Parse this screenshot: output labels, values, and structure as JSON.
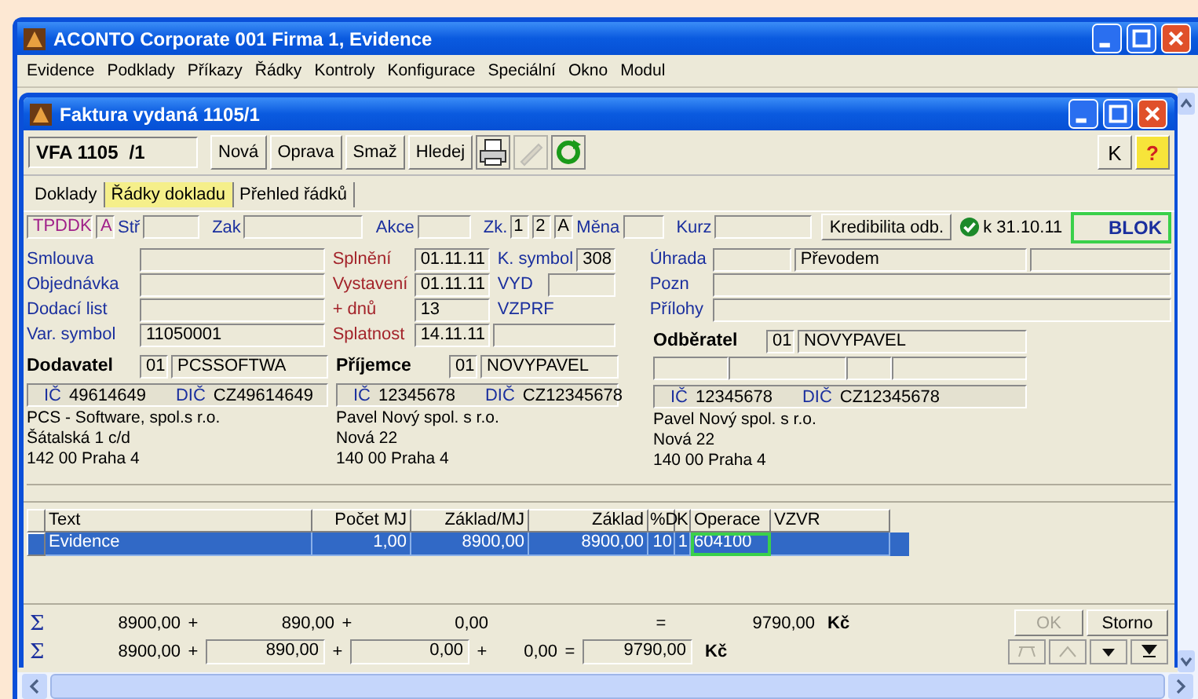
{
  "window": {
    "title": "ACONTO Corporate 001 Firma 1, Evidence"
  },
  "menu": [
    "Evidence",
    "Podklady",
    "Příkazy",
    "Řádky",
    "Kontroly",
    "Konfigurace",
    "Speciální",
    "Okno",
    "Modul"
  ],
  "document": {
    "title": "Faktura vydaná 1105/1",
    "toolbar": {
      "series": "VFA 1105",
      "number": "/1",
      "buttons": [
        "Nová",
        "Oprava",
        "Smaž",
        "Hledej"
      ],
      "icons": [
        {
          "kind": "print",
          "disabled": false
        },
        {
          "kind": "tool",
          "disabled": true
        },
        {
          "kind": "refresh",
          "disabled": false
        }
      ],
      "right_buttons": [
        "K",
        "?"
      ]
    },
    "tabs": [
      {
        "label": "Doklady",
        "selected": false
      },
      {
        "label": "Řádky dokladu",
        "selected": true
      },
      {
        "label": "Přehled řádků",
        "selected": false
      }
    ],
    "header": {
      "code": "TPDDK",
      "code_flag": "A",
      "str_label": "Stř",
      "zak_label": "Zak",
      "akce_label": "Akce",
      "zk_label": "Zk.",
      "zk_values": [
        "1",
        "2",
        "A"
      ],
      "mena_label": "Měna",
      "kurz_label": "Kurz",
      "credit_button": "Kredibilita odb.",
      "credit_ok": true,
      "credit_date": "k 31.10.11",
      "block": "BLOK",
      "block_highlighted": true
    },
    "left_fields": [
      {
        "label": "Smlouva"
      },
      {
        "label": "Objednávka"
      },
      {
        "label": "Dodací list"
      },
      {
        "label": "Var. symbol",
        "value": "11050001"
      }
    ],
    "middle_fields": [
      {
        "label": "Splnění",
        "value": "01.11.11",
        "label2": "K. symbol",
        "value2": "308"
      },
      {
        "label": "Vystavení",
        "value": "01.11.11",
        "label2": "VYD",
        "field2": true
      },
      {
        "label": "+ dnů",
        "value": "13",
        "label2": "VZPRF",
        "field2": false
      },
      {
        "label": "Splatnost",
        "value": "14.11.11",
        "field2": true
      }
    ],
    "right_fields": [
      {
        "label": "Úhrada",
        "value": "Převodem"
      },
      {
        "label": "Pozn"
      },
      {
        "label": "Přílohy"
      }
    ],
    "parties": [
      {
        "role": "Dodavatel",
        "code": "01",
        "name": "PCSSOFTWA",
        "ic_label": "IČ",
        "ic": "49614649",
        "dic_label": "DIČ",
        "dic": "CZ49614649",
        "address": [
          "PCS - Software, spol.s r.o.",
          "Šátalská 1 c/d",
          "142 00 Praha 4"
        ]
      },
      {
        "role": "Příjemce",
        "code": "01",
        "name": "NOVYPAVEL",
        "ic_label": "IČ",
        "ic": "12345678",
        "dic_label": "DIČ",
        "dic": "CZ12345678",
        "address": [
          "Pavel Nový spol. s r.o.",
          "Nová 22",
          "140 00 Praha 4"
        ]
      },
      {
        "role": "Odběratel",
        "code": "01",
        "name": "NOVYPAVEL",
        "ic_label": "IČ",
        "ic": "12345678",
        "dic_label": "DIČ",
        "dic": "CZ12345678",
        "address": [
          "Pavel Nový spol. s r.o.",
          "Nová 22",
          "140 00 Praha 4"
        ]
      }
    ],
    "table": {
      "columns": [
        "Text",
        "Počet MJ",
        "Základ/MJ",
        "Základ",
        "%D",
        "K",
        "Operace",
        "VZVR"
      ],
      "rows": [
        {
          "selected": true,
          "cells": [
            {
              "text": "Evidence",
              "highlighted": false
            },
            {
              "text": "1,00",
              "highlighted": false
            },
            {
              "text": "8900,00",
              "highlighted": false
            },
            {
              "text": "8900,00",
              "highlighted": false
            },
            {
              "text": "10",
              "highlighted": false
            },
            {
              "text": "1",
              "highlighted": false
            },
            {
              "text": "604100",
              "highlighted": true
            }
          ]
        }
      ]
    },
    "totals": [
      [
        {
          "kind": "sigma",
          "text": "Σ"
        },
        {
          "kind": "amount",
          "text": "8900,00"
        },
        {
          "kind": "op",
          "text": "+"
        },
        {
          "kind": "amount",
          "text": "890,00"
        },
        {
          "kind": "op",
          "text": "+"
        },
        {
          "kind": "amount",
          "text": "0,00"
        },
        {
          "kind": "gap"
        },
        {
          "kind": "op",
          "text": "="
        },
        {
          "kind": "amount",
          "text": "9790,00"
        },
        {
          "kind": "unit",
          "text": "Kč"
        }
      ],
      [
        {
          "kind": "sigma",
          "text": "Σ"
        },
        {
          "kind": "amount",
          "text": "8900,00"
        },
        {
          "kind": "op",
          "text": "+"
        },
        {
          "kind": "boxed",
          "text": "890,00"
        },
        {
          "kind": "op",
          "text": "+"
        },
        {
          "kind": "boxed",
          "text": "0,00"
        },
        {
          "kind": "op",
          "text": "+"
        },
        {
          "kind": "amount",
          "text": "0,00"
        },
        {
          "kind": "op",
          "text": "="
        },
        {
          "kind": "boxed",
          "text": "9790,00"
        },
        {
          "kind": "unit",
          "text": "Kč"
        }
      ]
    ],
    "actions": [
      {
        "label": "OK",
        "disabled": true
      },
      {
        "label": "Storno",
        "disabled": false
      }
    ],
    "nav": [
      {
        "kind": "tree",
        "disabled": true
      },
      {
        "kind": "up",
        "disabled": true
      },
      {
        "kind": "down",
        "disabled": false
      },
      {
        "kind": "last",
        "disabled": false
      }
    ]
  }
}
